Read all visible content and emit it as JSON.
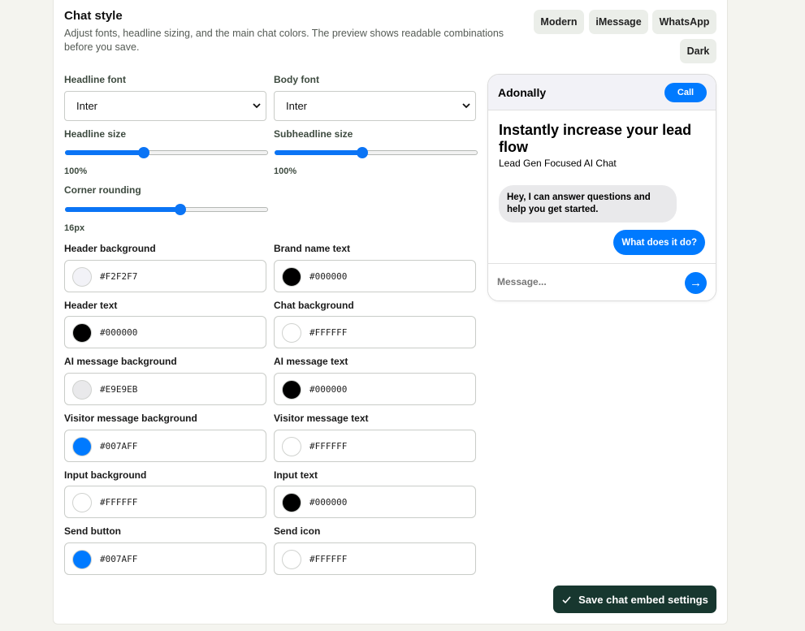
{
  "section": {
    "title": "Chat style",
    "description": "Adjust fonts, headline sizing, and the main chat colors. The preview shows readable combinations before you save."
  },
  "presets": [
    "Modern",
    "iMessage",
    "WhatsApp",
    "Dark"
  ],
  "fonts": {
    "headline_label": "Headline font",
    "headline_value": "Inter",
    "body_label": "Body font",
    "body_value": "Inter"
  },
  "sliders": {
    "headline_size": {
      "label": "Headline size",
      "value_text": "100%",
      "fraction": 0.38
    },
    "subheadline_size": {
      "label": "Subheadline size",
      "value_text": "100%",
      "fraction": 0.43
    },
    "corner_rounding": {
      "label": "Corner rounding",
      "value_text": "16px",
      "fraction": 0.57
    }
  },
  "colors": [
    {
      "label": "Header background",
      "hex": "#F2F2F7",
      "swatch": "#F2F2F7"
    },
    {
      "label": "Brand name text",
      "hex": "#000000",
      "swatch": "#000000"
    },
    {
      "label": "Header text",
      "hex": "#000000",
      "swatch": "#000000"
    },
    {
      "label": "Chat background",
      "hex": "#FFFFFF",
      "swatch": "#FFFFFF"
    },
    {
      "label": "AI message background",
      "hex": "#E9E9EB",
      "swatch": "#E9E9EB"
    },
    {
      "label": "AI message text",
      "hex": "#000000",
      "swatch": "#000000"
    },
    {
      "label": "Visitor message background",
      "hex": "#007AFF",
      "swatch": "#007AFF"
    },
    {
      "label": "Visitor message text",
      "hex": "#FFFFFF",
      "swatch": "#FFFFFF"
    },
    {
      "label": "Input background",
      "hex": "#FFFFFF",
      "swatch": "#FFFFFF"
    },
    {
      "label": "Input text",
      "hex": "#000000",
      "swatch": "#000000"
    },
    {
      "label": "Send button",
      "hex": "#007AFF",
      "swatch": "#007AFF"
    },
    {
      "label": "Send icon",
      "hex": "#FFFFFF",
      "swatch": "#FFFFFF"
    }
  ],
  "preview": {
    "brand": "Adonally",
    "call_label": "Call",
    "headline": "Instantly increase your lead flow",
    "subheadline": "Lead Gen Focused AI Chat",
    "ai_message": "Hey, I can answer questions and help you get started.",
    "visitor_message": "What does it do?",
    "input_placeholder": "Message...",
    "send_icon": "arrow-right-icon"
  },
  "save_button": {
    "label": "Save chat embed settings",
    "icon": "check-icon"
  },
  "accent_color": "#007AFF"
}
